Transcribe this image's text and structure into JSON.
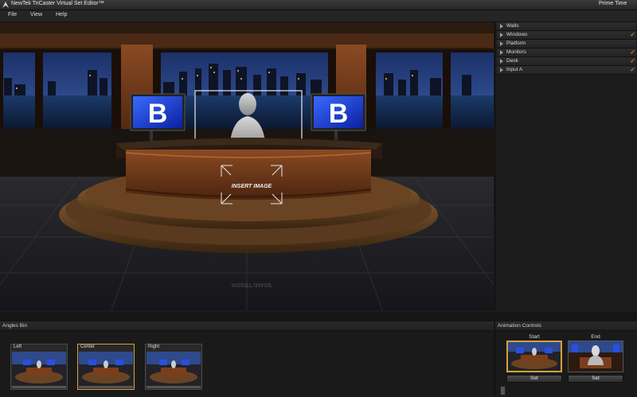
{
  "window": {
    "title": "NewTek TriCaster Virtual Set Editor™",
    "profile": "Prime Time"
  },
  "menu": {
    "items": [
      "File",
      "View",
      "Help"
    ]
  },
  "viewport": {
    "insert_label": "INSERT IMAGE",
    "reflection_label": "INSERT IMAGE",
    "monitor_letter": "B"
  },
  "layers": {
    "items": [
      {
        "label": "Walls",
        "checked": false
      },
      {
        "label": "Windows",
        "checked": true
      },
      {
        "label": "Platform",
        "checked": false
      },
      {
        "label": "Monitors",
        "checked": true
      },
      {
        "label": "Desk",
        "checked": true
      },
      {
        "label": "Input A",
        "checked": true
      }
    ]
  },
  "angles_bin": {
    "title": "Angles Bin",
    "angles": [
      {
        "label": "Left",
        "selected": false
      },
      {
        "label": "Center",
        "selected": true
      },
      {
        "label": "Right",
        "selected": false
      }
    ]
  },
  "animation": {
    "title": "Animation Controls",
    "start_label": "Start",
    "end_label": "End",
    "set_label": "Set",
    "set_label_2": "Set"
  },
  "colors": {
    "accent": "#d9a03a",
    "check": "#e8a83a",
    "monitor_blue": "#1f3fd6",
    "wood": "#7a3e1c"
  }
}
